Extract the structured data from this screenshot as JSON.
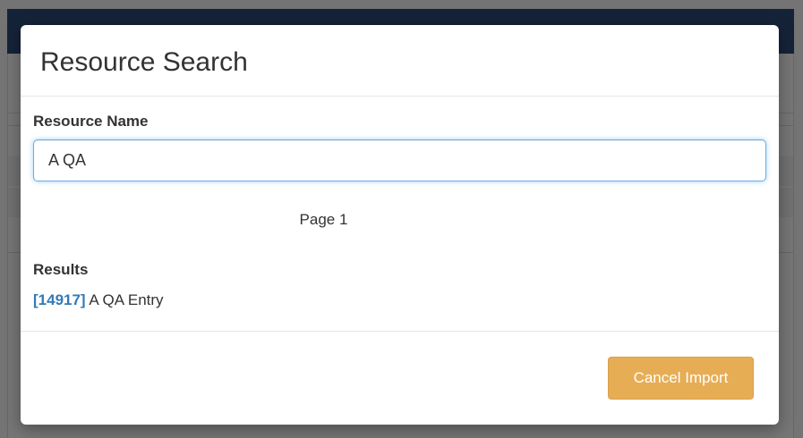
{
  "modal": {
    "title": "Resource Search",
    "search": {
      "label": "Resource Name",
      "value": "A QA"
    },
    "page_indicator": "Page 1",
    "results": {
      "heading": "Results",
      "items": [
        {
          "id": "[14917]",
          "name": "A QA Entry"
        }
      ]
    },
    "footer": {
      "cancel_label": "Cancel Import"
    }
  },
  "colors": {
    "navbar": "#2c4a78",
    "link": "#337ab7",
    "cancel_button": "#e7ad55",
    "input_focus_border": "#66afe9"
  }
}
